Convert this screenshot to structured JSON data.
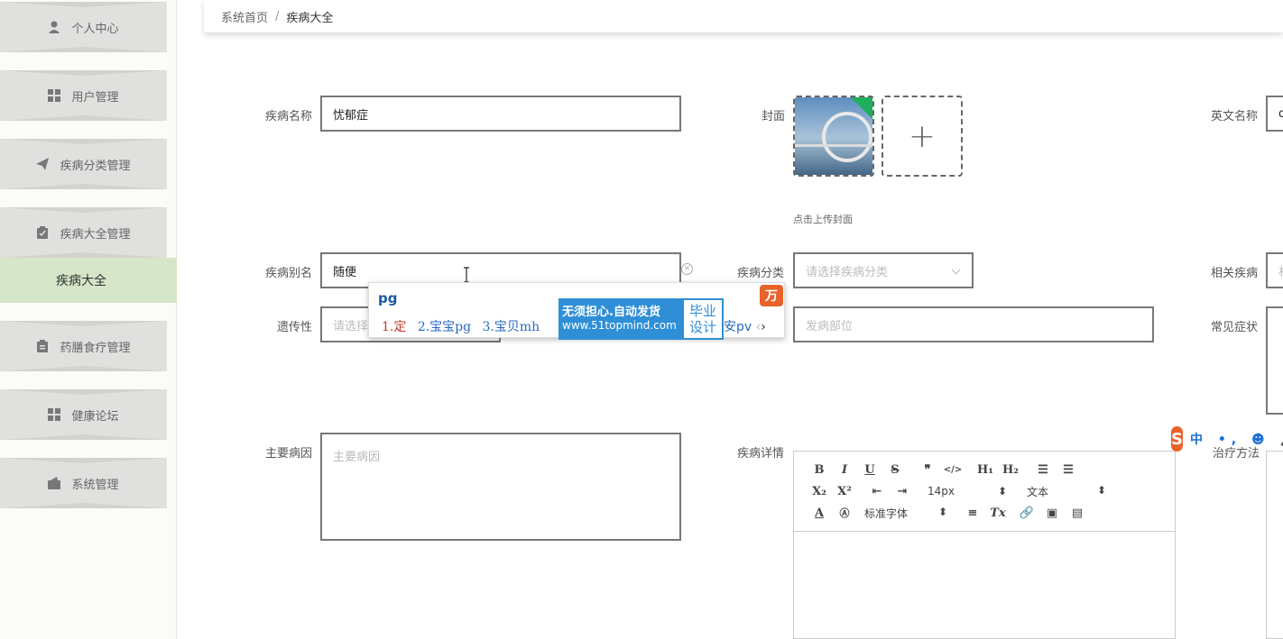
{
  "sidebar": {
    "items": [
      {
        "label": "个人中心",
        "icon": "user-icon"
      },
      {
        "label": "用户管理",
        "icon": "grid-icon"
      },
      {
        "label": "疾病分类管理",
        "icon": "send-icon"
      },
      {
        "label": "疾病大全管理",
        "icon": "clipboard-icon"
      },
      {
        "label": "药膳食疗管理",
        "icon": "clipboard-icon"
      },
      {
        "label": "健康论坛",
        "icon": "grid-icon"
      },
      {
        "label": "系统管理",
        "icon": "wallet-icon"
      }
    ],
    "active_sub": "疾病大全"
  },
  "breadcrumb": {
    "home": "系统首页",
    "separator": "/",
    "current": "疾病大全"
  },
  "form": {
    "name": {
      "label": "疾病名称",
      "value": "忧郁症"
    },
    "cover": {
      "label": "封面",
      "hint": "点击上传封面",
      "add": "+"
    },
    "english_name": {
      "label": "英文名称",
      "value": "d"
    },
    "alias": {
      "label": "疾病别名",
      "value": "随便"
    },
    "category": {
      "label": "疾病分类",
      "placeholder": "请选择疾病分类"
    },
    "related": {
      "label": "相关疾病",
      "placeholder": "相"
    },
    "heredity": {
      "label": "遗传性",
      "placeholder": "请选择"
    },
    "site": {
      "placeholder": "发病部位"
    },
    "symptoms": {
      "label": "常见症状"
    },
    "cause": {
      "label": "主要病因",
      "placeholder": "主要病因"
    },
    "detail": {
      "label": "疾病详情"
    },
    "treatment": {
      "label": "治疗方法"
    }
  },
  "editor": {
    "font_size": "14px",
    "text_type": "文本",
    "font_family": "标准字体"
  },
  "ime": {
    "typed": "pg",
    "cand1": "1.定",
    "cand2": "2.宝宝pg",
    "cand3": "3.宝贝mh",
    "ad_line1": "无须担心.自动发货",
    "ad_line2": "www.51topmind.com",
    "ad_right1": "毕业",
    "ad_right2": "设计",
    "tail": "安pv",
    "logo": "万"
  },
  "sogou": {
    "logo": "S",
    "text": "中 •, ☻ 🎤"
  }
}
